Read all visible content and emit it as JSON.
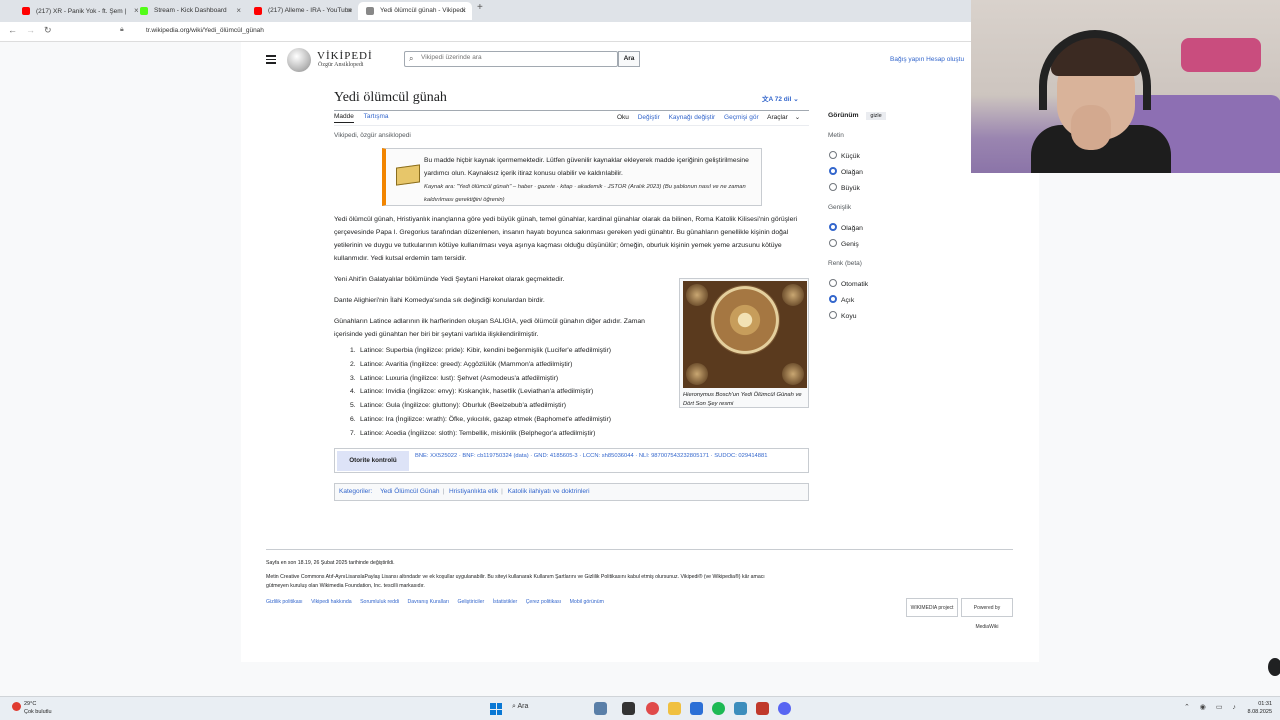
{
  "browser": {
    "tabs": [
      {
        "title": "(217) XR - Panik Yok - ft. Şem |",
        "color": "#ff0000"
      },
      {
        "title": "Stream - Kick Dashboard",
        "color": "#53fc18"
      },
      {
        "title": "(217) Alleme - IRA - YouTube",
        "color": "#ff0000"
      },
      {
        "title": "Yedi ölümcül günah - Vikipedi",
        "color": "#888888"
      }
    ],
    "url": "tr.wikipedia.org/wiki/Yedi_ölümcül_günah"
  },
  "wiki": {
    "logo_title": "VİKİPEDİ",
    "logo_sub": "Özgür Ansiklopedi",
    "search_placeholder": "Vikipedi üzerinde ara",
    "search_button": "Ara",
    "top_links": "Bağış yapın   Hesap oluştu",
    "title": "Yedi ölümcül günah",
    "languages": "72 dil",
    "tab_article": "Madde",
    "tab_talk": "Tartışma",
    "actions": [
      "Oku",
      "Değiştir",
      "Kaynağı değiştir",
      "Geçmişi gör",
      "Araçlar"
    ],
    "tagline": "Vikipedi, özgür ansiklopedi",
    "ambox_line1": "Bu madde hiçbir kaynak içermemektedir. Lütfen güvenilir kaynaklar ekleyerek madde içeriğinin geliştirilmesine yardımcı olun. Kaynaksız içerik itiraz konusu olabilir ve kaldırılabilir.",
    "ambox_line2": "Kaynak ara: \"Yedi ölümcül günah\" – haber · gazete · kitap · akademik · JSTOR (Aralık 2023) (Bu şablonun nasıl ve ne zaman kaldırılması gerektiğini öğrenin)",
    "para1": "Yedi ölümcül günah, Hristiyanlık inançlarına göre yedi büyük günah, temel günahlar, kardinal günahlar olarak da bilinen, Roma Katolik Kilisesi'nin görüşleri çerçevesinde Papa I. Gregorius tarafından düzenlenen, insanın hayatı boyunca sakınması gereken yedi günahtır. Bu günahların genellikle kişinin doğal yetilerinin ve duygu ve tutkularının kötüye kullanılması veya aşırıya kaçması olduğu düşünülür; örneğin, oburluk kişinin yemek yeme arzusunu kötüye kullanmıdır. Yedi kutsal erdemin tam tersidir.",
    "para2": "Yeni Ahit'in Galatyalılar bölümünde Yedi Şeytani Hareket olarak geçmektedir.",
    "para3": "Dante Alighieri'nin İlahi Komedya'sında sık değindiği konulardan birdir.",
    "para4": "Günahların Latince adlarının ilk harflerinden oluşan SALIGIA, yedi ölümcül günahın diğer adıdır. Zaman içerisinde yedi günahtan her biri bir şeytani varlıkla ilişkilendirilmiştir.",
    "sins": [
      "Latince: Superbia (İngilizce: pride): Kibir, kendini beğenmişlik (Lucifer'e atfedilmiştir)",
      "Latince: Avaritia (İngilizce: greed): Açgözlülük (Mammon'a atfedilmiştir)",
      "Latince: Luxuria (İngilizce: lust): Şehvet (Asmodeus'a atfedilmiştir)",
      "Latince: Invidia (İngilizce: envy): Kıskançlık, hasetlik (Leviathan'a atfedilmiştir)",
      "Latince: Gula (İngilizce: gluttony): Oburluk (Beelzebub'a atfedilmiştir)",
      "Latince: Ira (İngilizce: wrath): Öfke, yıkıcılık, gazap etmek (Baphomet'e atfedilmiştir)",
      "Latince: Acedia (İngilizce: sloth): Tembellik, miskinlik (Belphegor'a atfedilmiştir)"
    ],
    "figure_caption": "Hieronymus Bosch'un Yedi Ölümcül Günah ve Dört Son Şey resmi",
    "authority_label": "Otorite kontrolü",
    "authority_items": "BNE: XX525022 · BNF: cb119750324 (data) · GND: 4185605-3 · LCCN: sh85036044 · NLI: 987007543232805171 · SUDOC: 029414881",
    "categories_label": "Kategoriler:",
    "categories": [
      "Yedi Ölümcül Günah",
      "Hristiyanlıkta etik",
      "Katolik ilahiyatı ve doktrinleri"
    ],
    "footer_line1": "Sayfa en son 18.19, 26 Şubat 2025 tarihinde değiştirildi.",
    "footer_line2": "Metin Creative Commons Atıf-AynıLisanslaPaylaş Lisansı altındadır ve ek koşullar uygulanabilir. Bu siteyi kullanarak Kullanım Şartlarını ve Gizlilik Politikasını kabul etmiş olursunuz. Vikipedi® (ve Wikipedia®) kâr amacı gütmeyen kuruluş olan Wikimedia Foundation, Inc. tescilli markasıdır.",
    "footer_links": [
      "Gizlilik politikası",
      "Vikipedi hakkında",
      "Sorumluluk reddi",
      "Davranış Kuralları",
      "Geliştiriciler",
      "İstatistikler",
      "Çerez politikası",
      "Mobil görünüm"
    ],
    "badge1": "WIKIMEDIA project",
    "badge2": "Powered by MediaWiki"
  },
  "appearance": {
    "title": "Görünüm",
    "hide": "gizle",
    "text_label": "Metin",
    "text_options": [
      "Küçük",
      "Olağan",
      "Büyük"
    ],
    "width_label": "Genişlik",
    "width_options": [
      "Olağan",
      "Geniş"
    ],
    "color_label": "Renk (beta)",
    "color_options": [
      "Otomatik",
      "Açık",
      "Koyu"
    ]
  },
  "taskbar": {
    "weather_temp": "29°C",
    "weather_desc": "Çok bulutlu",
    "search": "Ara",
    "time": "01:31",
    "date": "8.08.2025"
  }
}
